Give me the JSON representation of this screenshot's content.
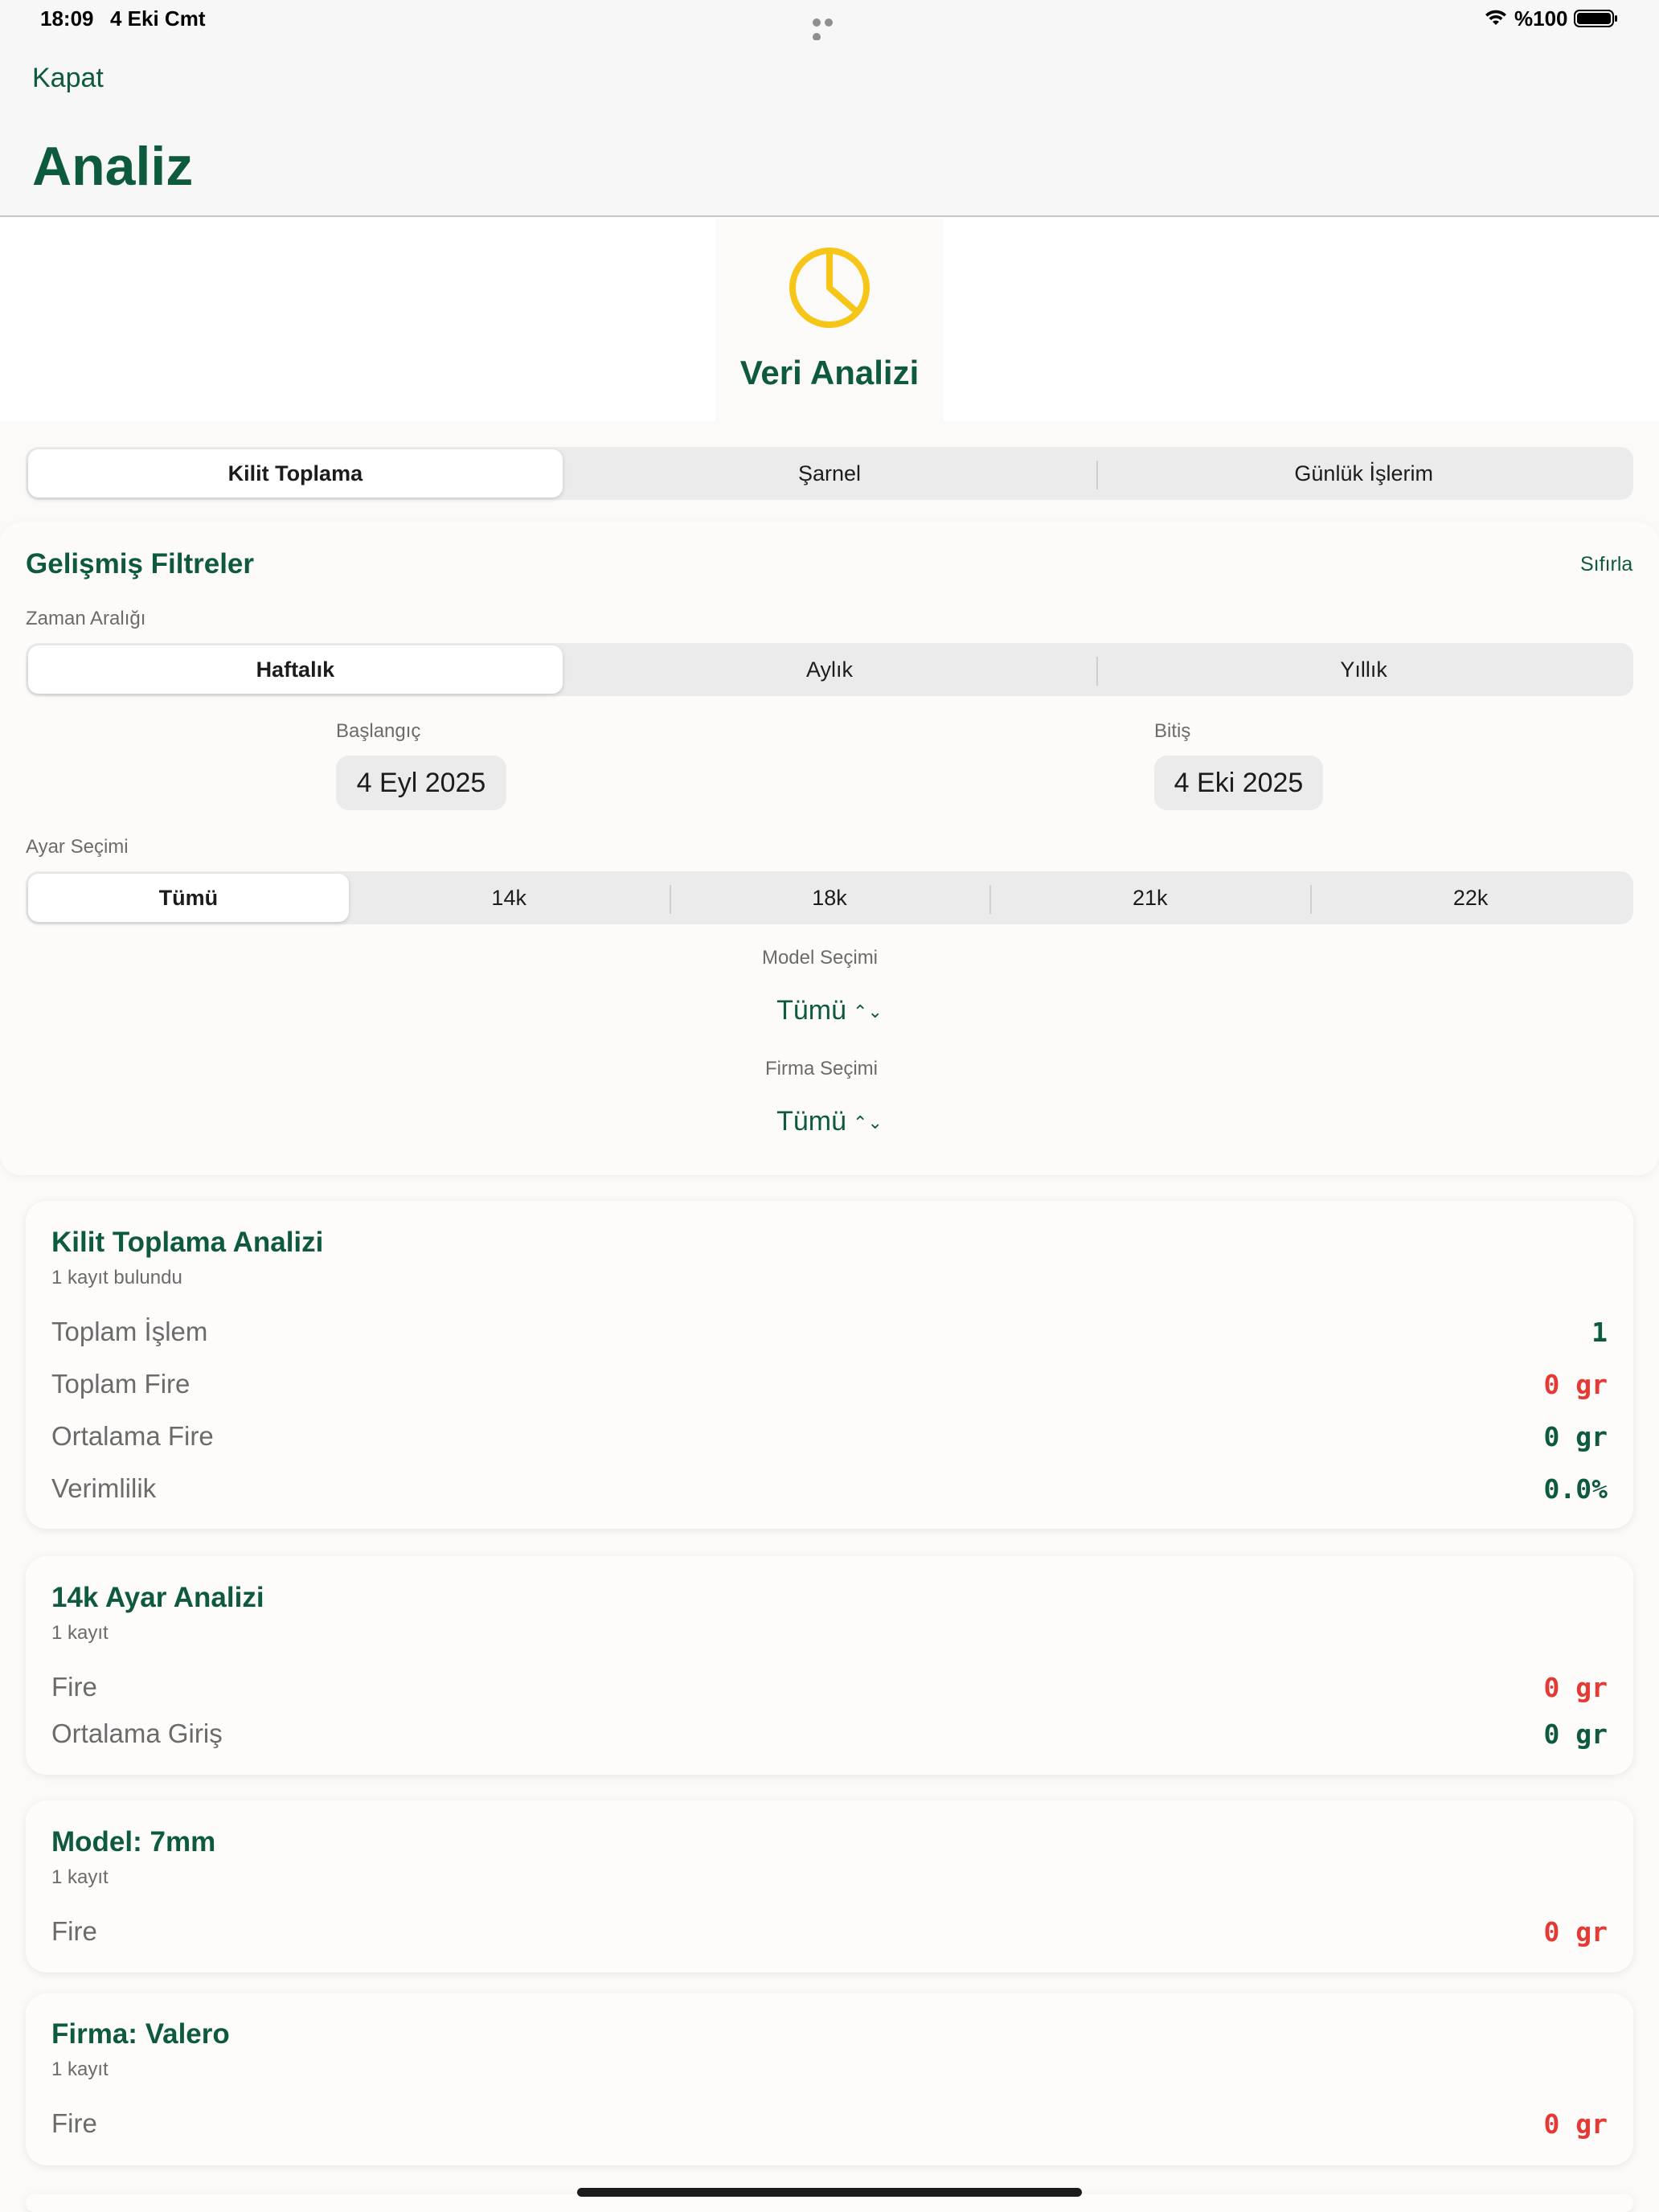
{
  "status_bar": {
    "time": "18:09",
    "date": "4 Eki Cmt",
    "battery": "%100"
  },
  "nav": {
    "close_label": "Kapat",
    "title": "Analiz"
  },
  "hero": {
    "icon": "pie-chart-icon",
    "title": "Veri Analizi",
    "accent_color": "#f5c518"
  },
  "main_tabs": [
    {
      "label": "Kilit Toplama",
      "selected": true
    },
    {
      "label": "Şarnel",
      "selected": false
    },
    {
      "label": "Günlük İşlerim",
      "selected": false
    }
  ],
  "filters": {
    "title": "Gelişmiş Filtreler",
    "reset_label": "Sıfırla",
    "time_range": {
      "label": "Zaman Aralığı",
      "options": [
        {
          "label": "Haftalık",
          "selected": true
        },
        {
          "label": "Aylık",
          "selected": false
        },
        {
          "label": "Yıllık",
          "selected": false
        }
      ]
    },
    "start": {
      "label": "Başlangıç",
      "value": "4 Eyl 2025"
    },
    "end": {
      "label": "Bitiş",
      "value": "4 Eki 2025"
    },
    "ayar": {
      "label": "Ayar Seçimi",
      "options": [
        {
          "label": "Tümü",
          "selected": true
        },
        {
          "label": "14k",
          "selected": false
        },
        {
          "label": "18k",
          "selected": false
        },
        {
          "label": "21k",
          "selected": false
        },
        {
          "label": "22k",
          "selected": false
        }
      ]
    },
    "model": {
      "label": "Model Seçimi",
      "value": "Tümü"
    },
    "firma": {
      "label": "Firma Seçimi",
      "value": "Tümü"
    }
  },
  "cards": {
    "summary": {
      "title": "Kilit Toplama Analizi",
      "subtitle": "1 kayıt bulundu",
      "rows": [
        {
          "label": "Toplam İşlem",
          "value": "1"
        },
        {
          "label": "Toplam Fire",
          "value": "0 gr"
        },
        {
          "label": "Ortalama Fire",
          "value": "0 gr"
        },
        {
          "label": "Verimlilik",
          "value": "0.0%"
        }
      ]
    },
    "ayar_14k": {
      "title": "14k Ayar Analizi",
      "subtitle": "1 kayıt",
      "rows": [
        {
          "label": "Fire",
          "value": "0 gr"
        },
        {
          "label": "Ortalama Giriş",
          "value": "0 gr"
        }
      ]
    },
    "model": {
      "title": "Model: 7mm",
      "subtitle": "1 kayıt",
      "rows": [
        {
          "label": "Fire",
          "value": "0 gr"
        }
      ]
    },
    "firma": {
      "title": "Firma: Valero",
      "subtitle": "1 kayıt",
      "rows": [
        {
          "label": "Fire",
          "value": "0 gr"
        }
      ]
    }
  },
  "colors": {
    "brand_green": "#0e5a3c",
    "negative_red": "#e53935"
  }
}
